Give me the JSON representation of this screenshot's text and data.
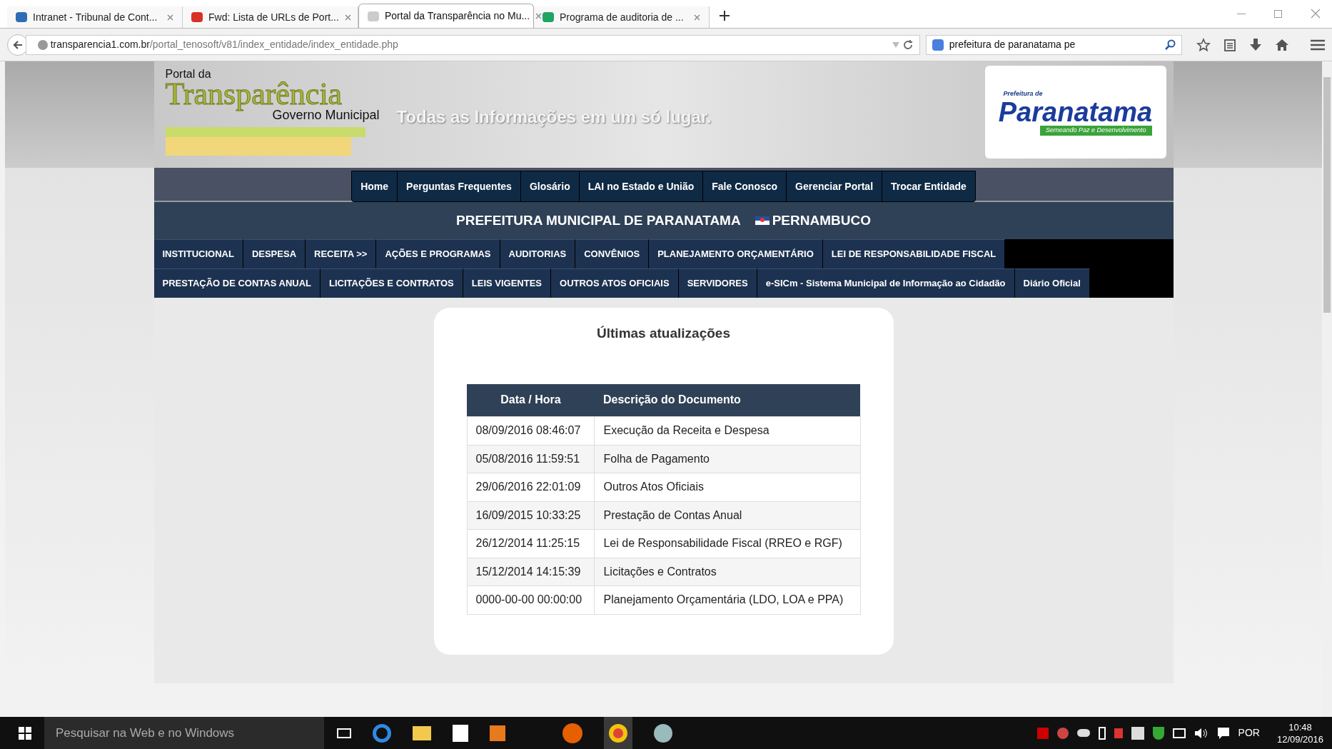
{
  "browser": {
    "tabs": [
      {
        "title": "Intranet - Tribunal de Cont...",
        "selected": false
      },
      {
        "title": "Fwd: Lista de URLs de Port...",
        "selected": false
      },
      {
        "title": "Portal da Transparência no Mu...",
        "selected": true
      },
      {
        "title": "Programa de auditoria de ...",
        "selected": false
      }
    ],
    "url_host": "transparencia1.com.br",
    "url_path": "/portal_tenosoft/v81/index_entidade/index_entidade.php",
    "search": "prefeitura de paranatama pe"
  },
  "header": {
    "portal_small": "Portal da",
    "portal_big": "Transparência",
    "portal_sub": "Governo Municipal",
    "tagline": "Todas as Informações em um só lugar.",
    "logo_top": "Prefeitura de",
    "logo_name": "Paranatama",
    "logo_motto": "Semeando Paz e Desenvolvimento"
  },
  "top_nav": [
    "Home",
    "Perguntas Frequentes",
    "Glosário",
    "LAI no Estado e União",
    "Fale Conosco",
    "Gerenciar Portal",
    "Trocar Entidade"
  ],
  "entity": {
    "name": "PREFEITURA MUNICIPAL DE PARANATAMA",
    "state": "PERNAMBUCO"
  },
  "menu_rows": [
    [
      "INSTITUCIONAL",
      "DESPESA",
      "RECEITA >>",
      "AÇÕES E PROGRAMAS",
      "AUDITORIAS",
      "CONVÊNIOS",
      "PLANEJAMENTO ORÇAMENTÁRIO",
      "LEI DE RESPONSABILIDADE FISCAL"
    ],
    [
      "PRESTAÇÃO DE CONTAS ANUAL",
      "LICITAÇÕES E CONTRATOS",
      "LEIS VIGENTES",
      "OUTROS ATOS OFICIAIS",
      "SERVIDORES",
      "e-SICm - Sistema Municipal de Informação ao Cidadão",
      "Diário Oficial"
    ]
  ],
  "updates": {
    "title": "Últimas atualizações",
    "columns": [
      "Data / Hora",
      "Descrição do Documento"
    ],
    "rows": [
      [
        "08/09/2016 08:46:07",
        "Execução da Receita e Despesa"
      ],
      [
        "05/08/2016 11:59:51",
        "Folha de Pagamento"
      ],
      [
        "29/06/2016 22:01:09",
        "Outros Atos Oficiais"
      ],
      [
        "16/09/2015 10:33:25",
        "Prestação de Contas Anual"
      ],
      [
        "26/12/2014 11:25:15",
        "Lei de Responsabilidade Fiscal (RREO e RGF)"
      ],
      [
        "15/12/2014 14:15:39",
        "Licitações e Contratos"
      ],
      [
        "0000-00-00 00:00:00",
        "Planejamento Orçamentária (LDO, LOA e PPA)"
      ]
    ]
  },
  "taskbar": {
    "search_placeholder": "Pesquisar na Web e no Windows",
    "language": "POR",
    "time": "10:48",
    "date": "12/09/2016"
  }
}
